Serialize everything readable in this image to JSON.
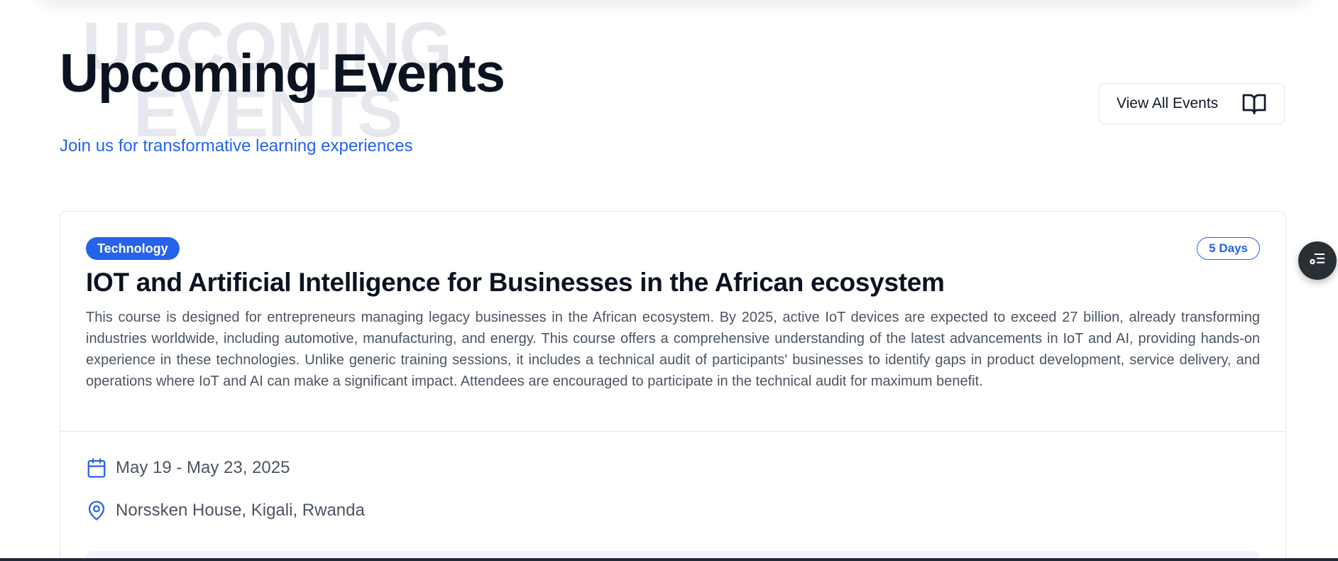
{
  "header": {
    "background_word_1": "UPCOMING",
    "background_word_2": "EVENTS",
    "title": "Upcoming Events",
    "subtitle": "Join us for transformative learning experiences",
    "view_all_label": "View All Events",
    "view_all_icon": "book-open-icon"
  },
  "event": {
    "category": "Technology",
    "duration": "5 Days",
    "title": "IOT and Artificial Intelligence for Businesses in the African ecosystem",
    "description": "This course is designed for entrepreneurs managing legacy businesses in the African ecosystem. By 2025, active IoT devices are expected to exceed 27 billion, already transforming industries worldwide, including automotive, manufacturing, and energy. This course offers a comprehensive understanding of the latest advancements in IoT and AI, providing hands-on experience in these technologies. Unlike generic training sessions, it includes a technical audit of participants' businesses to identify gaps in product development, service delivery, and operations where IoT and AI can make a significant impact. Attendees are encouraged to participate in the technical audit for maximum benefit.",
    "date_range": "May 19 - May 23, 2025",
    "date_icon": "calendar-icon",
    "location": "Norssken House, Kigali, Rwanda",
    "location_icon": "map-pin-icon"
  },
  "floating_action": {
    "icon": "accessibility-menu-icon"
  },
  "colors": {
    "accent": "#2563eb",
    "title_text": "#0b1220",
    "body_text": "#4b5563",
    "background_word": "#e6e8ee",
    "border": "#e5e7eb",
    "floating_button": "#2a2f36"
  }
}
